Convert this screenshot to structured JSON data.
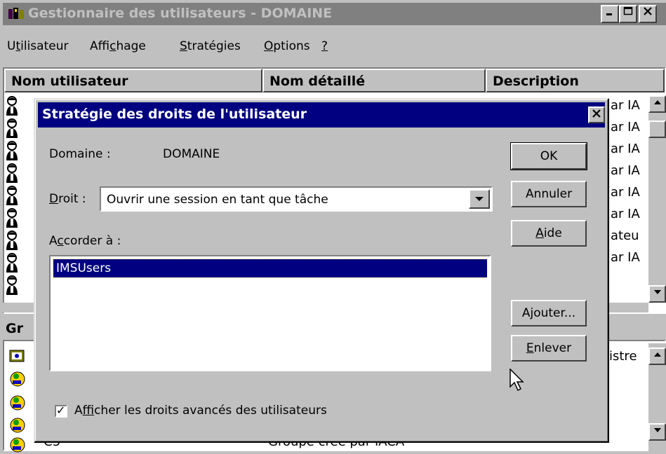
{
  "main_window": {
    "title": "Gestionnaire des utilisateurs - DOMAINE",
    "caption_buttons": [
      "minimize-icon",
      "maximize-icon",
      "close-icon"
    ]
  },
  "menu": [
    {
      "before": "U",
      "underline": "t",
      "after": "ilisateur"
    },
    {
      "before": "Affi",
      "underline": "c",
      "after": "hage"
    },
    {
      "before": "",
      "underline": "S",
      "after": "tratégies"
    },
    {
      "before": "",
      "underline": "O",
      "after": "ptions"
    },
    {
      "before": "",
      "underline": "?",
      "after": ""
    }
  ],
  "user_list": {
    "columns": [
      "Nom utilisateur",
      "Nom détaillé",
      "Description"
    ],
    "row_count": 9,
    "visible_description_fragments": [
      "ar IA",
      "ar IA",
      "ar IA",
      "ar IA",
      "ar IA",
      "ar IA",
      "ateu",
      "ar IA"
    ]
  },
  "groups": {
    "header_fragment": "Gr",
    "visible_description_fragment": "istre",
    "bottom_row_name": "C3",
    "bottom_row_description": "Groupe créé par IACA"
  },
  "dialog": {
    "title": "Stratégie des droits de l'utilisateur",
    "domain_label": "Domaine :",
    "domain_value": "DOMAINE",
    "right_label": {
      "underline": "D",
      "after": "roit :"
    },
    "right_value": "Ouvrir une session en tant que tâche",
    "grant_label": {
      "before": "A",
      "underline": "c",
      "after": "corder à :"
    },
    "grant_items": [
      "IMSUsers"
    ],
    "buttons": {
      "ok": "OK",
      "cancel": "Annuler",
      "help": {
        "before": "",
        "underline": "A",
        "after": "ide"
      },
      "add": {
        "before": "A",
        "underline": "j",
        "after": "outer..."
      },
      "remove": {
        "before": "",
        "underline": "E",
        "after": "nlever"
      }
    },
    "advanced_checkbox": {
      "checked": true,
      "label": {
        "before": "A",
        "underline": "f",
        "after": "ficher les droits avancés des utilisateurs"
      }
    }
  },
  "colors": {
    "face": "#c0c0c0",
    "inactive_title": "#808080",
    "active_title": "#000080",
    "selection": "#000080"
  }
}
